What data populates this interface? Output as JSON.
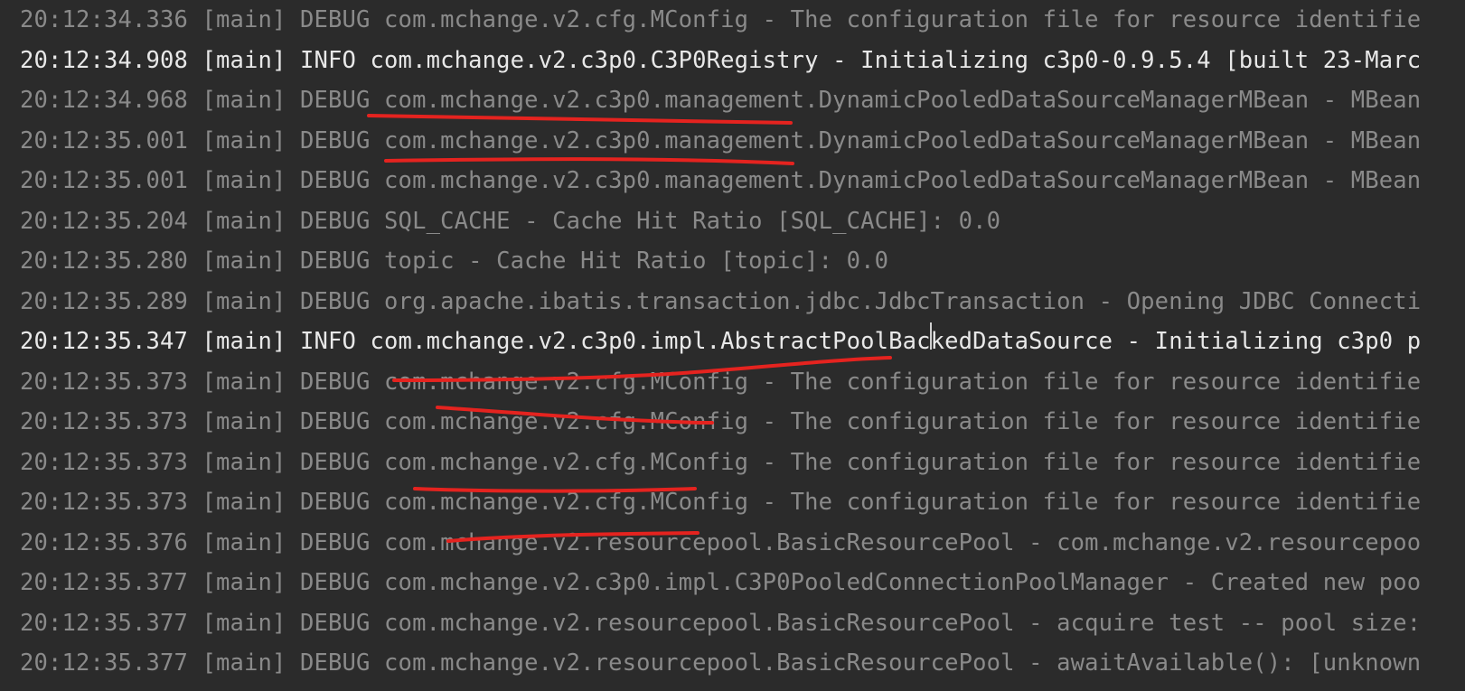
{
  "console": {
    "lines": [
      {
        "level": "debug",
        "text": "20:12:34.336 [main] DEBUG com.mchange.v2.cfg.MConfig - The configuration file for resource identifie"
      },
      {
        "level": "info",
        "text": "20:12:34.908 [main] INFO com.mchange.v2.c3p0.C3P0Registry - Initializing c3p0-0.9.5.4 [built 23-Marc"
      },
      {
        "level": "debug",
        "text": "20:12:34.968 [main] DEBUG com.mchange.v2.c3p0.management.DynamicPooledDataSourceManagerMBean - MBean"
      },
      {
        "level": "debug",
        "text": "20:12:35.001 [main] DEBUG com.mchange.v2.c3p0.management.DynamicPooledDataSourceManagerMBean - MBean"
      },
      {
        "level": "debug",
        "text": "20:12:35.001 [main] DEBUG com.mchange.v2.c3p0.management.DynamicPooledDataSourceManagerMBean - MBean"
      },
      {
        "level": "debug",
        "text": "20:12:35.204 [main] DEBUG SQL_CACHE - Cache Hit Ratio [SQL_CACHE]: 0.0"
      },
      {
        "level": "debug",
        "text": "20:12:35.280 [main] DEBUG topic - Cache Hit Ratio [topic]: 0.0"
      },
      {
        "level": "debug",
        "text": "20:12:35.289 [main] DEBUG org.apache.ibatis.transaction.jdbc.JdbcTransaction - Opening JDBC Connecti"
      },
      {
        "level": "info",
        "text": "20:12:35.347 [main] INFO com.mchange.v2.c3p0.impl.AbstractPoolBackedDataSource - Initializing c3p0 p"
      },
      {
        "level": "debug",
        "text": "20:12:35.373 [main] DEBUG com.mchange.v2.cfg.MConfig - The configuration file for resource identifie"
      },
      {
        "level": "debug",
        "text": "20:12:35.373 [main] DEBUG com.mchange.v2.cfg.MConfig - The configuration file for resource identifie"
      },
      {
        "level": "debug",
        "text": "20:12:35.373 [main] DEBUG com.mchange.v2.cfg.MConfig - The configuration file for resource identifie"
      },
      {
        "level": "debug",
        "text": "20:12:35.373 [main] DEBUG com.mchange.v2.cfg.MConfig - The configuration file for resource identifie"
      },
      {
        "level": "debug",
        "text": "20:12:35.376 [main] DEBUG com.mchange.v2.resourcepool.BasicResourcePool - com.mchange.v2.resourcepoo"
      },
      {
        "level": "debug",
        "text": "20:12:35.377 [main] DEBUG com.mchange.v2.c3p0.impl.C3P0PooledConnectionPoolManager - Created new poo"
      },
      {
        "level": "debug",
        "text": "20:12:35.377 [main] DEBUG com.mchange.v2.resourcepool.BasicResourcePool - acquire test -- pool size:"
      },
      {
        "level": "debug",
        "text": "20:12:35.377 [main] DEBUG com.mchange.v2.resourcepool.BasicResourcePool - awaitAvailable(): [unknown"
      }
    ]
  },
  "colors": {
    "background": "#2b2b2b",
    "debug_text": "#8a8a8a",
    "info_text": "#e8e8e8",
    "annotation_stroke": "#e5231f"
  }
}
